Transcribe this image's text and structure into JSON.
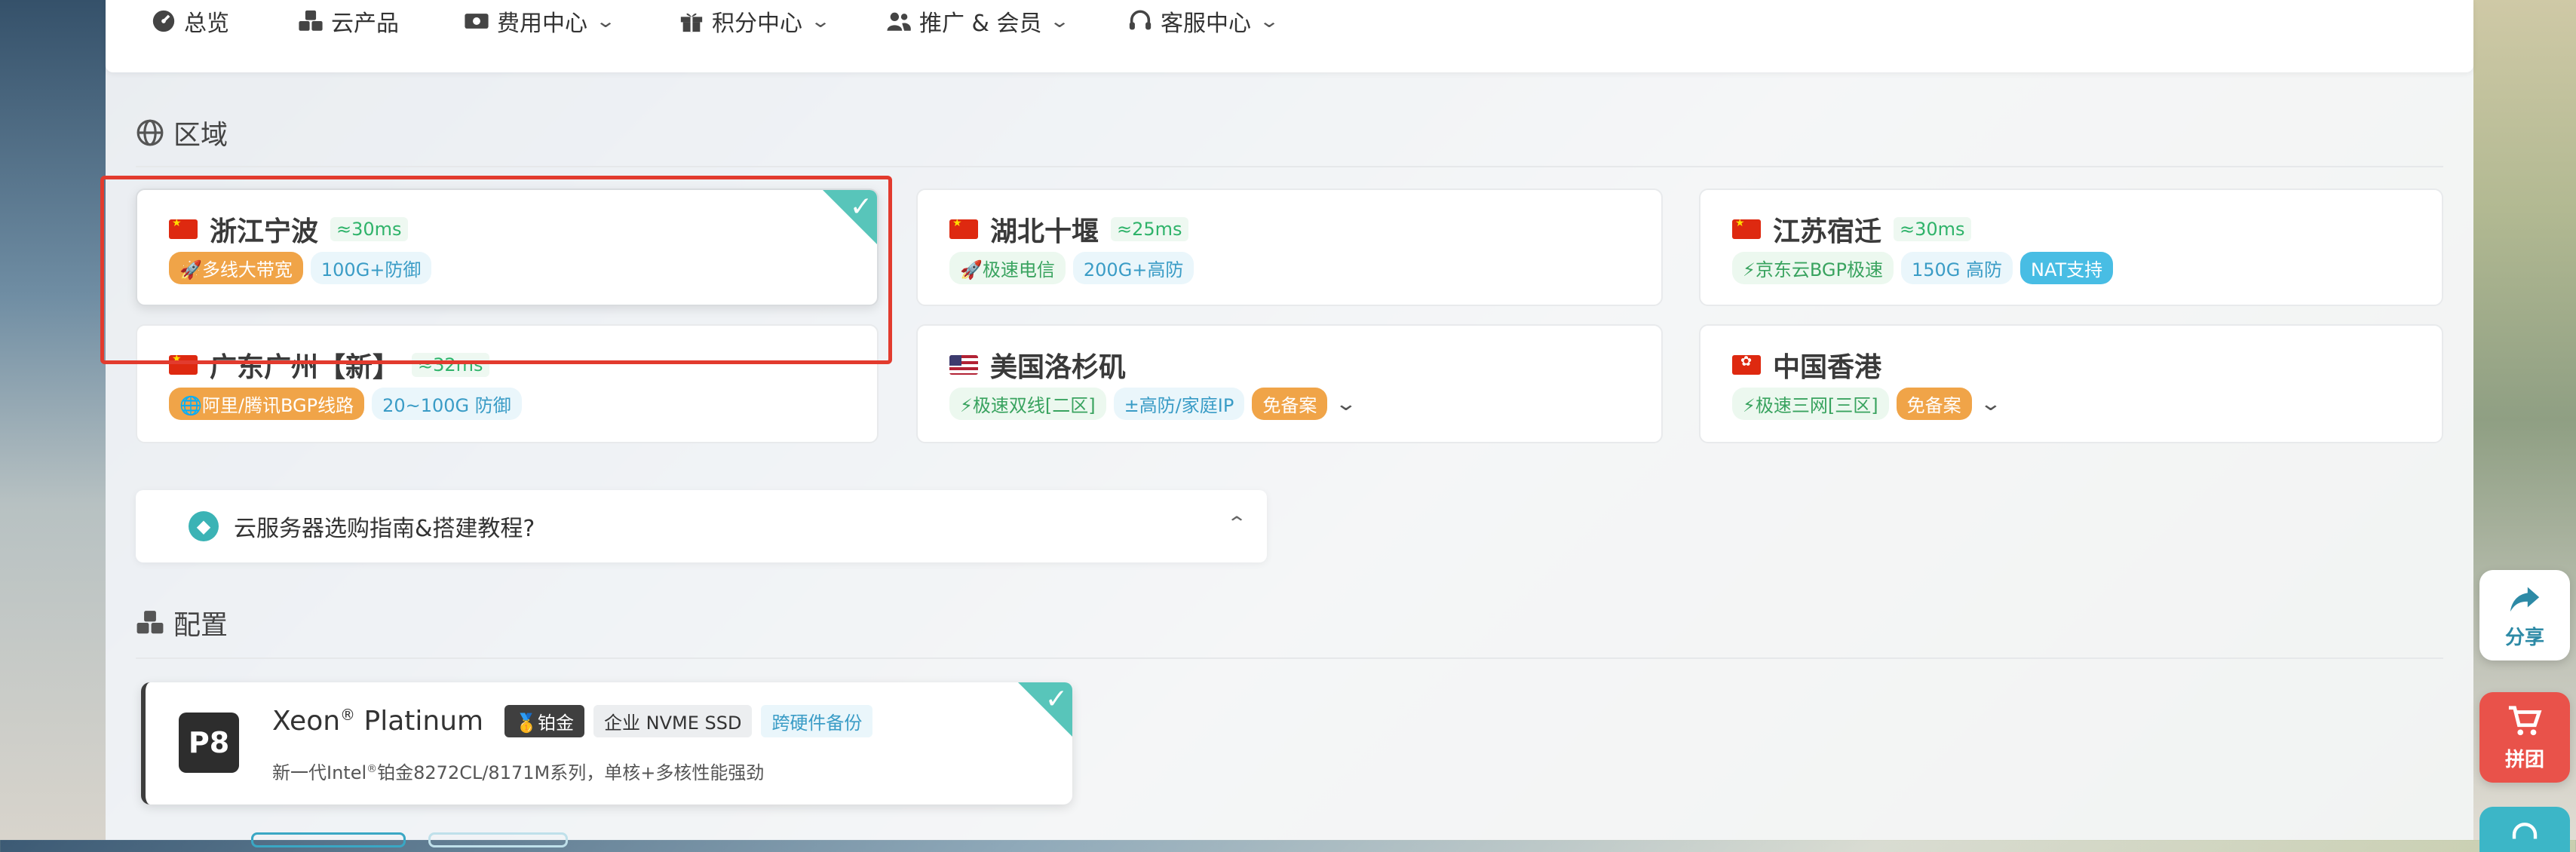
{
  "nav": {
    "items": [
      {
        "label": "总览",
        "icon": "dashboard-icon",
        "dropdown": false
      },
      {
        "label": "云产品",
        "icon": "cubes-icon",
        "dropdown": false
      },
      {
        "label": "费用中心",
        "icon": "money-icon",
        "dropdown": true
      },
      {
        "label": "积分中心",
        "icon": "gift-icon",
        "dropdown": true
      },
      {
        "label": "推广 & 会员",
        "icon": "users-icon",
        "dropdown": true
      },
      {
        "label": "客服中心",
        "icon": "headset-icon",
        "dropdown": true
      }
    ]
  },
  "region_section": {
    "title": "区域",
    "icon": "globe-icon",
    "regions": [
      {
        "flag": "CN",
        "name": "浙江宁波",
        "latency": "≈30ms",
        "selected": true,
        "tags": [
          "🚀多线大带宽",
          "100G+防御"
        ]
      },
      {
        "flag": "CN",
        "name": "湖北十堰",
        "latency": "≈25ms",
        "selected": false,
        "tags": [
          "🚀极速电信",
          "200G+高防"
        ]
      },
      {
        "flag": "CN",
        "name": "江苏宿迁",
        "latency": "≈30ms",
        "selected": false,
        "tags": [
          "⚡京东云BGP极速",
          "150G 高防",
          "NAT支持"
        ]
      },
      {
        "flag": "CN",
        "name": "广东广州【新】",
        "latency": "≈32ms",
        "selected": false,
        "tags": [
          "🌐阿里/腾讯BGP线路",
          "20~100G 防御"
        ]
      },
      {
        "flag": "US",
        "name": "美国洛杉矶",
        "latency": "",
        "selected": false,
        "tags": [
          "⚡极速双线[二区]",
          "±高防/家庭IP",
          "免备案"
        ]
      },
      {
        "flag": "HK",
        "name": "中国香港",
        "latency": "",
        "selected": false,
        "tags": [
          "⚡极速三网[三区]",
          "免备案"
        ]
      }
    ]
  },
  "guide": {
    "label": "云服务器选购指南&搭建教程?",
    "icon": "compass-icon"
  },
  "config_section": {
    "title": "配置",
    "icon": "cubes-icon",
    "cpu": {
      "badge": "P8",
      "name": "Xeon",
      "reg": "®",
      "name_suffix": " Platinum",
      "tags": [
        "🥇铂金",
        "企业 NVME SSD",
        "跨硬件备份"
      ],
      "desc_prefix": "新一代Intel",
      "desc_reg": "®",
      "desc_suffix": "铂金8272CL/8171M系列，单核+多核性能强劲",
      "selected": true
    }
  },
  "side": {
    "share_label": "分享",
    "group_label": "拼团"
  },
  "colors": {
    "accent_teal": "#58c5ba",
    "highlight_red": "#e23b2e",
    "tag_orange": "#f0a448",
    "group_red": "#e9524a"
  }
}
